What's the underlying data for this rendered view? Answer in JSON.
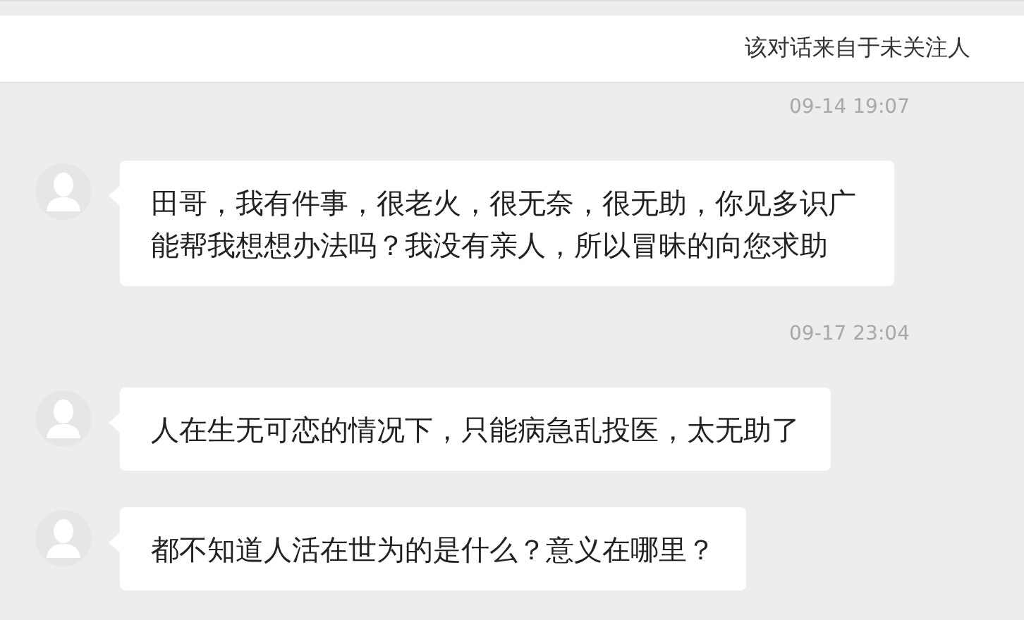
{
  "notice": "该对话来自于未关注人",
  "items": [
    {
      "kind": "timestamp",
      "text": "09-14 19:07"
    },
    {
      "kind": "message",
      "text": "田哥，我有件事，很老火，很无奈，很无助，你见多识广能帮我想想办法吗？我没有亲人，所以冒昧的向您求助"
    },
    {
      "kind": "timestamp",
      "text": "09-17 23:04"
    },
    {
      "kind": "message",
      "text": "人在生无可恋的情况下，只能病急乱投医，太无助了"
    },
    {
      "kind": "message",
      "text": "都不知道人活在世为的是什么？意义在哪里？"
    }
  ]
}
